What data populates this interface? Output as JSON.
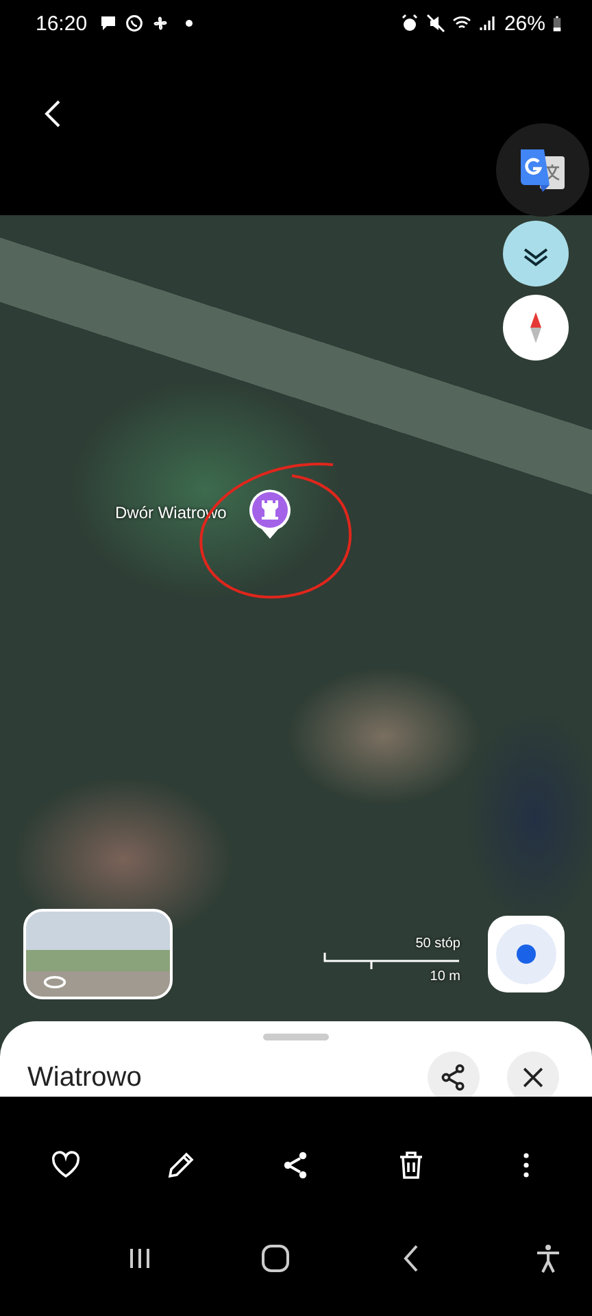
{
  "status_bar": {
    "time": "16:20",
    "battery": "26%"
  },
  "map": {
    "place_label": "Dwór Wiatrowo",
    "scale": {
      "imperial": "50 stóp",
      "metric": "10 m"
    }
  },
  "sheet": {
    "title": "Wiatrowo"
  }
}
